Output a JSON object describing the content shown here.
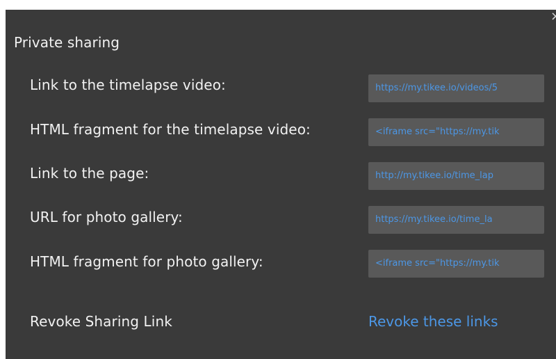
{
  "dialog": {
    "close_glyph": "×",
    "title": "Private sharing",
    "rows": [
      {
        "label": "Link to the timelapse video:",
        "value": "https://my.tikee.io/videos/5"
      },
      {
        "label": "HTML fragment for the timelapse video:",
        "value": "<iframe src=\"https://my.tik"
      },
      {
        "label": "Link to the page:",
        "value": "http://my.tikee.io/time_lap"
      },
      {
        "label": "URL for photo gallery:",
        "value": "https://my.tikee.io/time_la"
      },
      {
        "label": "HTML fragment for photo gallery:",
        "value": "<iframe src=\"https://my.tik"
      }
    ],
    "revoke": {
      "label": "Revoke Sharing Link",
      "action": "Revoke these links"
    }
  },
  "colors": {
    "panel_bg": "#3a3a3a",
    "field_bg": "#595959",
    "text": "#f2f2f2",
    "accent": "#4c97e6"
  }
}
